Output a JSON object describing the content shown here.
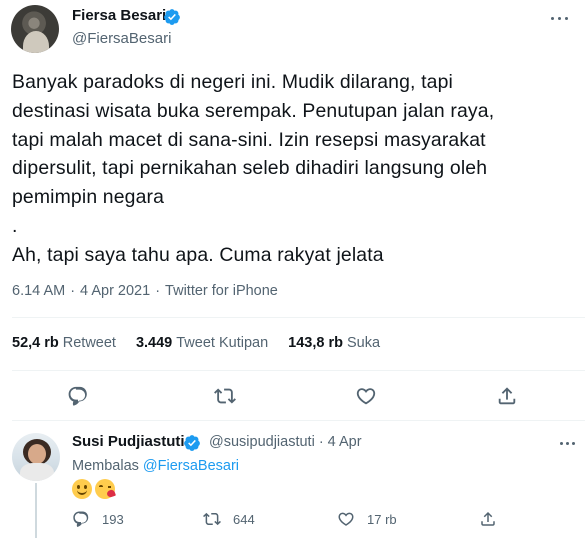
{
  "tweet": {
    "author_name": "Fiersa Besari",
    "author_handle": "@FiersaBesari",
    "text_lines": [
      "Banyak paradoks di negeri ini. Mudik dilarang, tapi",
      "destinasi wisata buka serempak. Penutupan jalan raya,",
      "tapi malah macet di sana-sini. Izin resepsi masyarakat",
      "dipersulit, tapi pernikahan seleb dihadiri langsung oleh",
      "pemimpin negara",
      ".",
      "Ah, tapi saya tahu apa. Cuma rakyat jelata"
    ],
    "time": "6.14 AM",
    "date": "4 Apr 2021",
    "source": "Twitter for iPhone",
    "stats": {
      "retweets_count": "52,4 rb",
      "retweets_label": "Retweet",
      "quotes_count": "3.449",
      "quotes_label": "Tweet Kutipan",
      "likes_count": "143,8 rb",
      "likes_label": "Suka"
    }
  },
  "reply": {
    "author_name": "Susi Pudjiastuti",
    "handle_and_date": "@susipudjiastuti · 4 Apr",
    "replying_prefix": "Membalas",
    "replying_to": "@FiersaBesari",
    "emojis": [
      "slightly-smiling-face",
      "face-blowing-kiss"
    ],
    "reply_count": "193",
    "retweet_count": "644",
    "like_count": "17 rb"
  },
  "colors": {
    "text_primary": "#0f1419",
    "text_secondary": "#536471",
    "accent": "#1d9bf0",
    "divider": "#eff3f4"
  }
}
